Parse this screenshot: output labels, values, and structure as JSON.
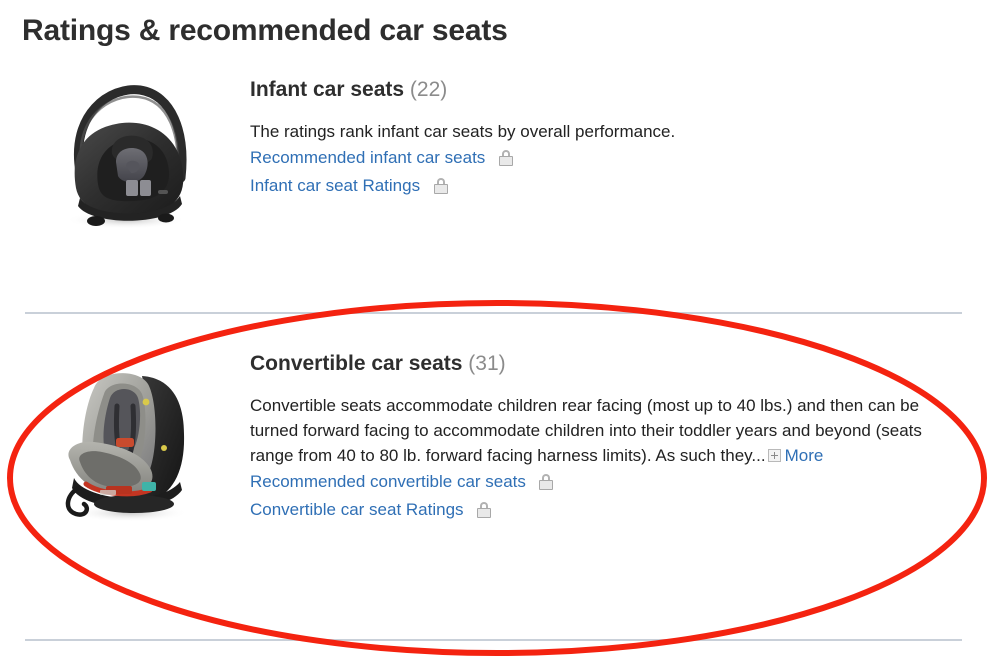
{
  "page": {
    "title": "Ratings & recommended car seats",
    "background_color": "#ffffff"
  },
  "colors": {
    "link": "#2f6fb5",
    "heading": "#2e2e2e",
    "count_grey": "#8b8b8b",
    "body_text": "#222222",
    "divider": "#c9d0d9",
    "annotation_red": "#f42310"
  },
  "sections": [
    {
      "id": "infant-car-seats",
      "heading_name": "Infant car seats",
      "heading_count": "(22)",
      "description": "The ratings rank infant car seats by overall performance.",
      "has_more": false,
      "more_label": "",
      "thumbnail_alt": "infant-car-seat-photo",
      "links": [
        {
          "label": "Recommended infant car seats",
          "locked": true,
          "lock_icon": "lock-icon"
        },
        {
          "label": "Infant car seat Ratings",
          "locked": true,
          "lock_icon": "lock-icon"
        }
      ]
    },
    {
      "id": "convertible-car-seats",
      "heading_name": "Convertible car seats",
      "heading_count": "(31)",
      "description": "Convertible seats accommodate children rear facing (most up to 40 lbs.) and then can be turned forward facing to accommodate children into their toddler years and beyond (seats range from 40 to 80 lb. forward facing harness limits). As such they...",
      "has_more": true,
      "more_label": "More",
      "more_icon": "plus-box-icon",
      "thumbnail_alt": "convertible-car-seat-photo",
      "links": [
        {
          "label": "Recommended convertible car seats",
          "locked": true,
          "lock_icon": "lock-icon"
        },
        {
          "label": "Convertible car seat Ratings",
          "locked": true,
          "lock_icon": "lock-icon"
        }
      ]
    }
  ],
  "annotation": {
    "type": "ellipse-highlight",
    "target": "convertible-car-seats",
    "color": "#f42310",
    "stroke_width": "6"
  }
}
